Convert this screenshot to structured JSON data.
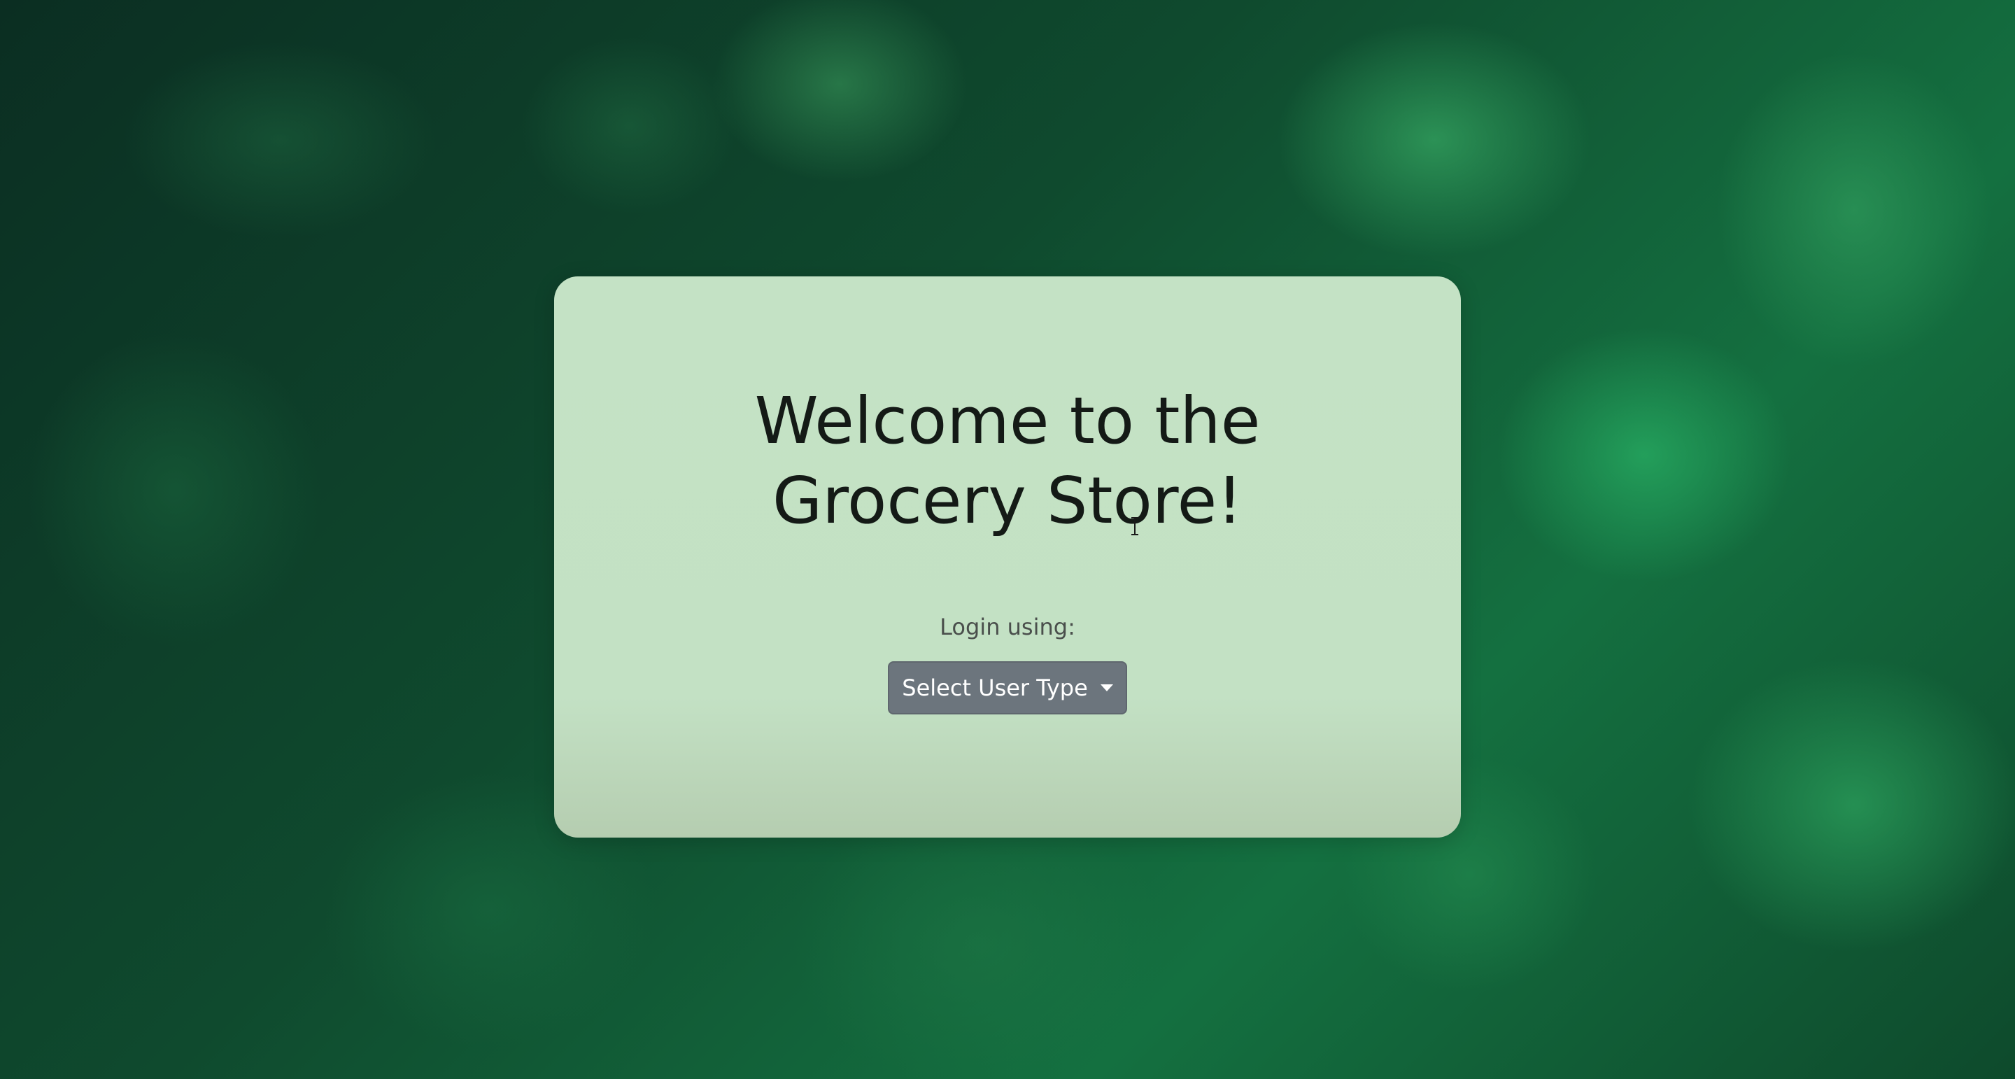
{
  "page": {
    "background_colors": [
      "#0b2e22",
      "#147040",
      "#2eaa60"
    ]
  },
  "card": {
    "background_color": "#c4e2c5",
    "title_line1": "Welcome to the",
    "title_line2": "Grocery Store!",
    "login_label": "Login using:",
    "dropdown": {
      "selected_label": "Select User Type",
      "icon": "caret-down-icon",
      "color": "#6c757d"
    }
  },
  "cursor": {
    "icon": "text-cursor-icon"
  }
}
